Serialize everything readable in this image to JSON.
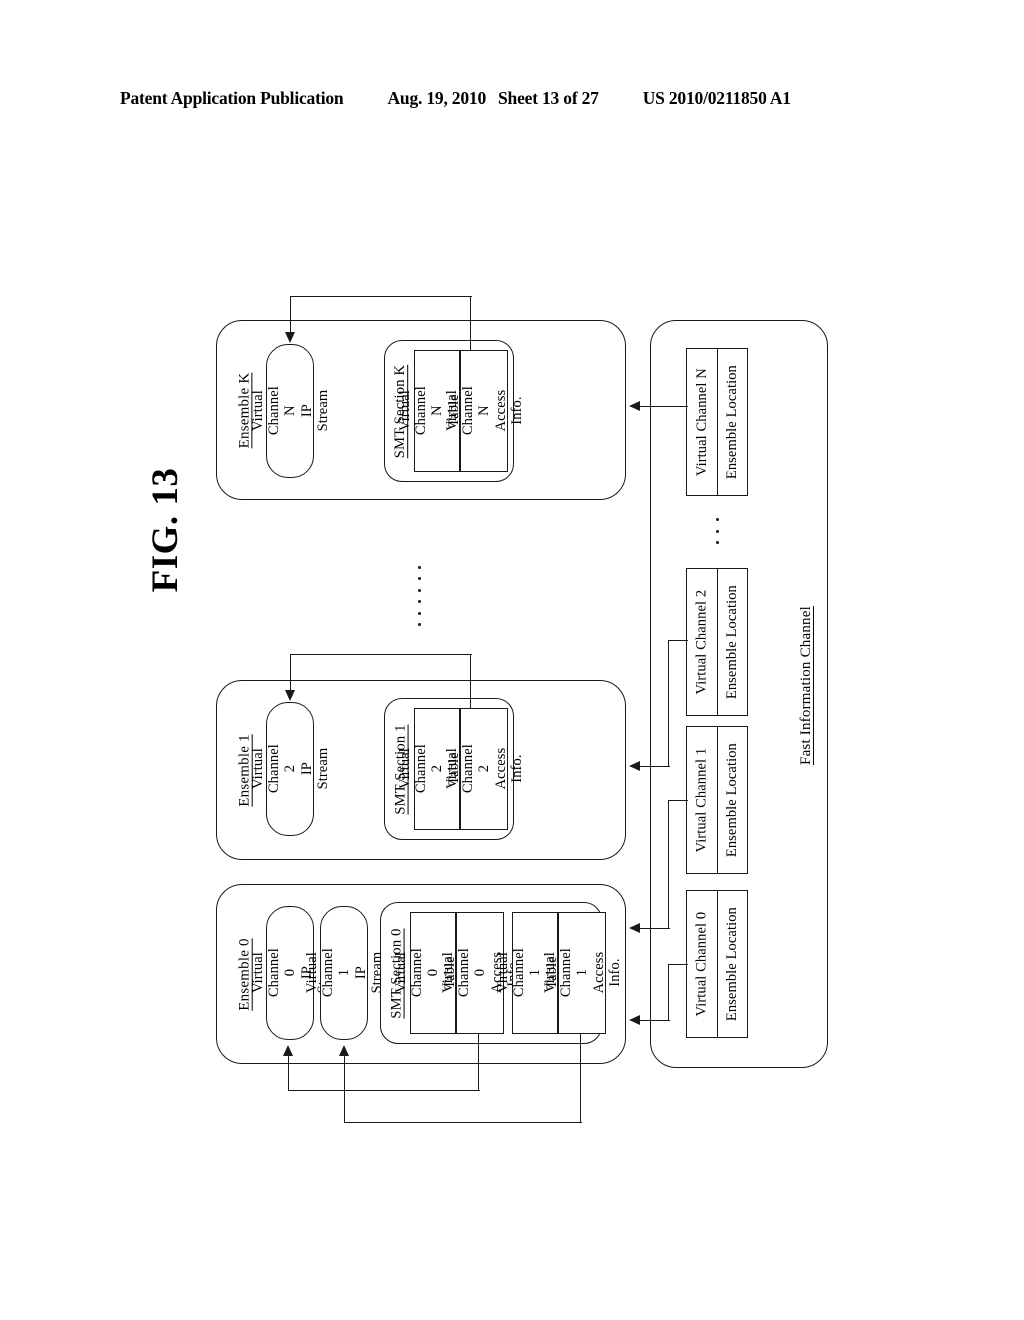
{
  "header": {
    "publication": "Patent Application Publication",
    "date": "Aug. 19, 2010",
    "sheet": "Sheet 13 of 27",
    "number": "US 2010/0211850 A1"
  },
  "figure": {
    "label": "FIG. 13"
  },
  "ensembles": [
    {
      "id": "ensemble-k",
      "title": "Ensemble K",
      "ip_streams": [
        {
          "id": "ip-stream-n",
          "label": "Virtual Channel N\nIP Stream"
        }
      ],
      "smt": {
        "id": "smt-section-k",
        "title": "SMT Section K",
        "entries": [
          {
            "table_entry": "Virtual Channel N\nTable Entry",
            "access_info": "Virtual Channel N\nAccess Info."
          }
        ]
      }
    },
    {
      "id": "ensemble-1",
      "title": "Ensemble 1",
      "ip_streams": [
        {
          "id": "ip-stream-2",
          "label": "Virtual Channel 2\nIP Stream"
        }
      ],
      "smt": {
        "id": "smt-section-1",
        "title": "SMT Section 1",
        "entries": [
          {
            "table_entry": "Virtual Channel 2\nTable Entry",
            "access_info": "Virtual Channel 2\nAccess Info."
          }
        ]
      }
    },
    {
      "id": "ensemble-0",
      "title": "Ensemble 0",
      "ip_streams": [
        {
          "id": "ip-stream-0",
          "label": "Virtual Channel 0\nIP Stream"
        },
        {
          "id": "ip-stream-1",
          "label": "Virtual Channel 1\nIP Stream"
        }
      ],
      "smt": {
        "id": "smt-section-0",
        "title": "SMT Section 0",
        "entries": [
          {
            "table_entry": "Virtual Channel 0\nTable Entry",
            "access_info": "Virtual Channel 0\nAccess Info."
          },
          {
            "table_entry": "Virtual Channel 1\nTable Entry",
            "access_info": "Virtual Channel 1\nAccess Info."
          }
        ]
      }
    }
  ],
  "fic": {
    "title": "Fast Information Channel",
    "entries": [
      {
        "id": "fic-entry-n",
        "channel": "Virtual Channel N",
        "location": "Ensemble Location"
      },
      {
        "id": "fic-entry-2",
        "channel": "Virtual Channel 2",
        "location": "Ensemble Location"
      },
      {
        "id": "fic-entry-1",
        "channel": "Virtual Channel 1",
        "location": "Ensemble Location"
      },
      {
        "id": "fic-entry-0",
        "channel": "Virtual Channel 0",
        "location": "Ensemble Location"
      }
    ]
  },
  "ellipsis": {
    "between_ensembles": "......",
    "fic_gap": "..."
  },
  "colors": {
    "stroke": "#1a1a1a",
    "background": "#ffffff"
  }
}
